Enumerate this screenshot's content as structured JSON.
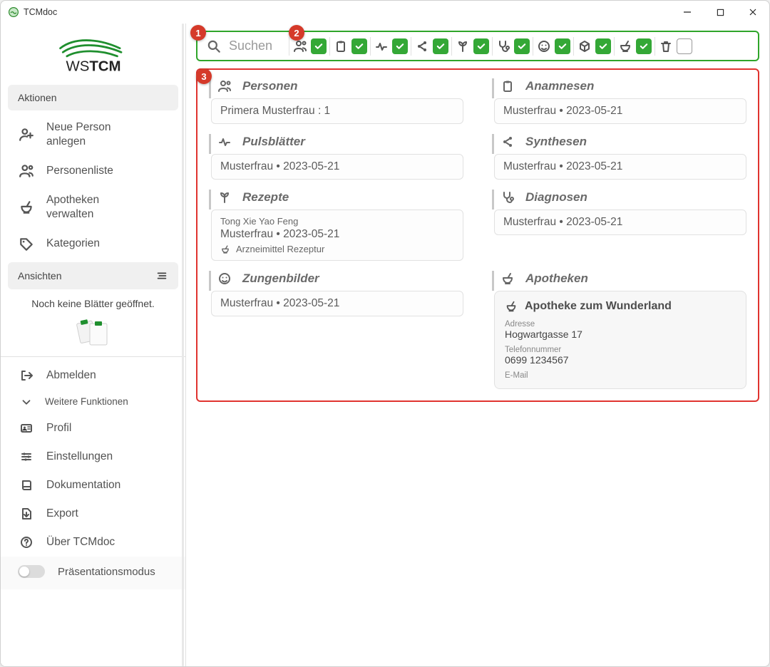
{
  "window": {
    "title": "TCMdoc"
  },
  "logo": {
    "text": "WSTCM"
  },
  "sidebar": {
    "aktionen_label": "Aktionen",
    "items": [
      {
        "icon": "user-plus",
        "label": "Neue Person anlegen"
      },
      {
        "icon": "people",
        "label": "Personenliste"
      },
      {
        "icon": "mortar",
        "label": "Apotheken verwalten"
      },
      {
        "icon": "tag",
        "label": "Kategorien"
      }
    ],
    "ansichten_label": "Ansichten",
    "ansichten_blurb": "Noch keine Blätter geöffnet.",
    "footer": [
      {
        "icon": "logout",
        "label": "Abmelden",
        "size": "normal"
      },
      {
        "icon": "chevron-down",
        "label": "Weitere Funktionen",
        "size": "small"
      },
      {
        "icon": "id-card",
        "label": "Profil",
        "size": "normal"
      },
      {
        "icon": "sliders",
        "label": "Einstellungen",
        "size": "normal"
      },
      {
        "icon": "book",
        "label": "Dokumentation",
        "size": "normal"
      },
      {
        "icon": "export",
        "label": "Export",
        "size": "normal"
      },
      {
        "icon": "help",
        "label": "Über TCMdoc",
        "size": "normal"
      }
    ],
    "presentation_label": "Präsentationsmodus"
  },
  "toolbar": {
    "search_placeholder": "Suchen",
    "filters": [
      {
        "icon": "people",
        "checked": true
      },
      {
        "icon": "clipboard",
        "checked": true
      },
      {
        "icon": "heartbeat",
        "checked": true
      },
      {
        "icon": "share",
        "checked": true
      },
      {
        "icon": "sprout",
        "checked": true
      },
      {
        "icon": "stethoscope",
        "checked": true
      },
      {
        "icon": "face",
        "checked": true
      },
      {
        "icon": "cube",
        "checked": true
      },
      {
        "icon": "mortar",
        "checked": true
      },
      {
        "icon": "trash",
        "checked": false
      }
    ]
  },
  "annotations": {
    "m1": "1",
    "m2": "2",
    "m3": "3"
  },
  "results": {
    "personen": {
      "title": "Personen",
      "icon": "people",
      "items": [
        {
          "text": "Primera Musterfrau : 1"
        }
      ]
    },
    "anamnesen": {
      "title": "Anamnesen",
      "icon": "clipboard",
      "items": [
        {
          "text": "Musterfrau • 2023-05-21"
        }
      ]
    },
    "pulsblaetter": {
      "title": "Pulsblätter",
      "icon": "heartbeat",
      "items": [
        {
          "text": "Musterfrau • 2023-05-21"
        }
      ]
    },
    "synthesen": {
      "title": "Synthesen",
      "icon": "share",
      "items": [
        {
          "text": "Musterfrau • 2023-05-21"
        }
      ]
    },
    "rezepte": {
      "title": "Rezepte",
      "icon": "sprout",
      "items": [
        {
          "pre": "Tong Xie Yao Feng",
          "text": "Musterfrau • 2023-05-21",
          "sub": "Arzneimittel Rezeptur",
          "subicon": "mortar"
        }
      ]
    },
    "diagnosen": {
      "title": "Diagnosen",
      "icon": "stethoscope",
      "items": [
        {
          "text": "Musterfrau • 2023-05-21"
        }
      ]
    },
    "zungenbilder": {
      "title": "Zungenbilder",
      "icon": "face",
      "items": [
        {
          "text": "Musterfrau • 2023-05-21"
        }
      ]
    },
    "apotheken": {
      "title": "Apotheken",
      "icon": "mortar",
      "pharmacy": {
        "name": "Apotheke zum Wunderland",
        "addr_label": "Adresse",
        "addr": "Hogwartgasse 17",
        "tel_label": "Telefonnummer",
        "tel": "0699 1234567",
        "mail_label": "E-Mail"
      }
    }
  }
}
